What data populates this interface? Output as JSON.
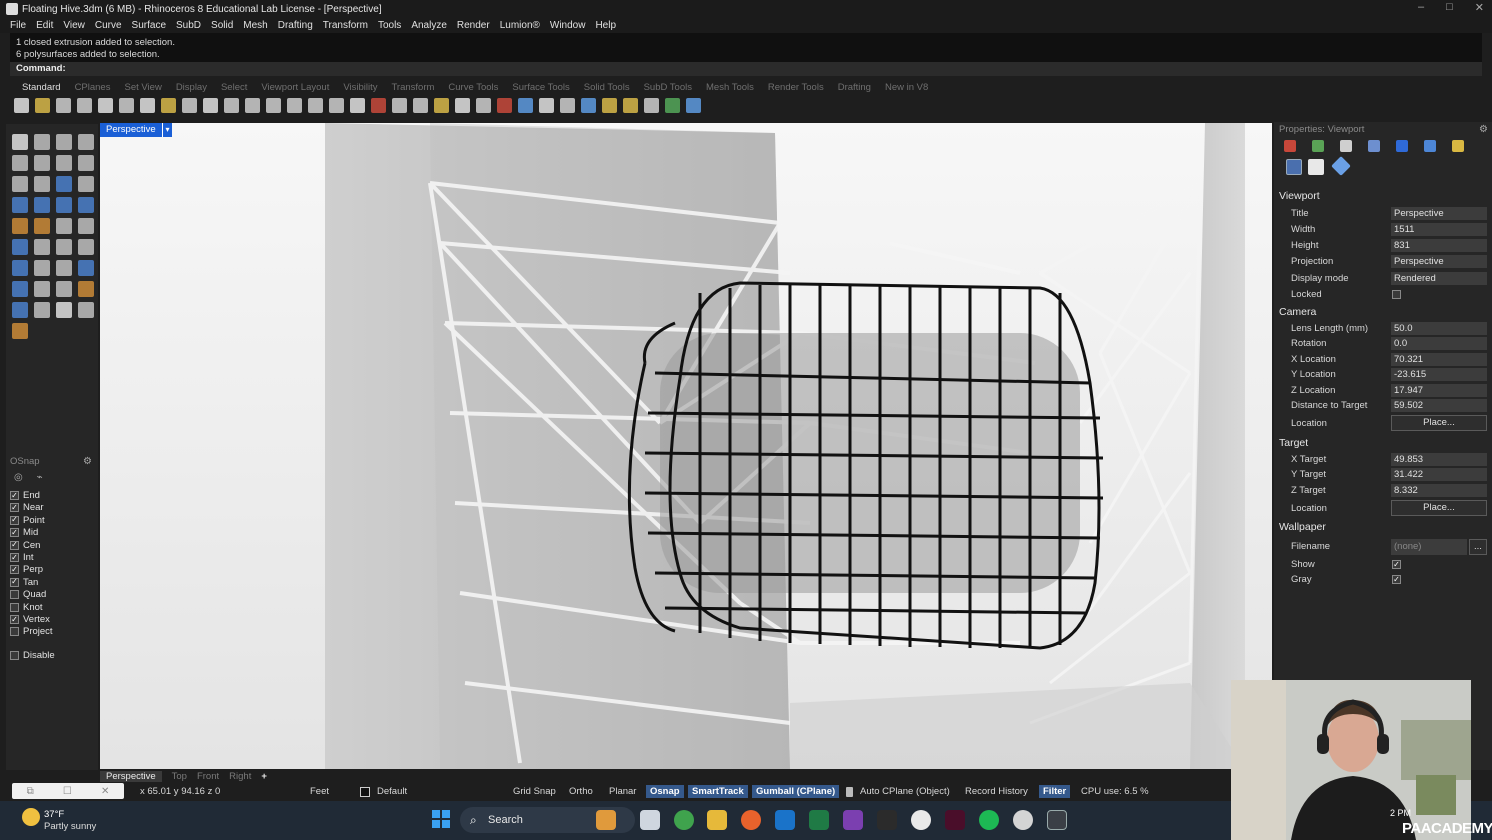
{
  "window": {
    "title": "Floating Hive.3dm (6 MB) - Rhinoceros 8 Educational Lab License - [Perspective]",
    "controls": [
      "–",
      "□",
      "✕"
    ]
  },
  "menu": [
    "File",
    "Edit",
    "View",
    "Curve",
    "Surface",
    "SubD",
    "Solid",
    "Mesh",
    "Drafting",
    "Transform",
    "Tools",
    "Analyze",
    "Render",
    "Lumion®",
    "Window",
    "Help"
  ],
  "command_history": [
    "1 closed extrusion added to selection.",
    "6 polysurfaces added to selection."
  ],
  "command_prompt": "Command:",
  "toolbar_tabs": [
    "Standard",
    "CPlanes",
    "Set View",
    "Display",
    "Select",
    "Viewport Layout",
    "Visibility",
    "Transform",
    "Curve Tools",
    "Surface Tools",
    "Solid Tools",
    "SubD Tools",
    "Mesh Tools",
    "Render Tools",
    "Drafting",
    "New in V8"
  ],
  "viewport": {
    "label": "Perspective",
    "tabs": [
      "Perspective",
      "Top",
      "Front",
      "Right"
    ],
    "add_tab": "+"
  },
  "osnap": {
    "title": "OSnap",
    "items": [
      {
        "label": "End",
        "checked": true
      },
      {
        "label": "Near",
        "checked": true
      },
      {
        "label": "Point",
        "checked": true
      },
      {
        "label": "Mid",
        "checked": true
      },
      {
        "label": "Cen",
        "checked": true
      },
      {
        "label": "Int",
        "checked": true
      },
      {
        "label": "Perp",
        "checked": true
      },
      {
        "label": "Tan",
        "checked": true
      },
      {
        "label": "Quad",
        "checked": false
      },
      {
        "label": "Knot",
        "checked": false
      },
      {
        "label": "Vertex",
        "checked": true
      },
      {
        "label": "Project",
        "checked": false
      }
    ],
    "disable": {
      "label": "Disable",
      "checked": false
    }
  },
  "properties": {
    "title": "Properties: Viewport",
    "viewport_section": "Viewport",
    "title_label": "Title",
    "title_value": "Perspective",
    "width_label": "Width",
    "width_value": "1511",
    "height_label": "Height",
    "height_value": "831",
    "projection_label": "Projection",
    "projection_value": "Perspective",
    "display_label": "Display mode",
    "display_value": "Rendered",
    "locked_label": "Locked",
    "camera_section": "Camera",
    "lens_label": "Lens Length (mm)",
    "lens_value": "50.0",
    "rotation_label": "Rotation",
    "rotation_value": "0.0",
    "xloc_label": "X Location",
    "xloc_value": "70.321",
    "yloc_label": "Y Location",
    "yloc_value": "-23.615",
    "zloc_label": "Z Location",
    "zloc_value": "17.947",
    "dist_label": "Distance to Target",
    "dist_value": "59.502",
    "cam_location_label": "Location",
    "place_label": "Place...",
    "target_section": "Target",
    "xt_label": "X Target",
    "xt_value": "49.853",
    "yt_label": "Y Target",
    "yt_value": "31.422",
    "zt_label": "Z Target",
    "zt_value": "8.332",
    "tgt_location_label": "Location",
    "wallpaper_section": "Wallpaper",
    "filename_label": "Filename",
    "filename_value": "(none)",
    "filename_browse": "...",
    "show_label": "Show",
    "gray_label": "Gray"
  },
  "status": {
    "coords": "x 65.01  y 94.16  z 0",
    "units": "Feet",
    "layer": "Default",
    "grid_snap": "Grid Snap",
    "ortho": "Ortho",
    "planar": "Planar",
    "osnap": "Osnap",
    "smarttrack": "SmartTrack",
    "gumball": "Gumball (CPlane)",
    "auto_cplane": "Auto CPlane (Object)",
    "record_history": "Record History",
    "filter": "Filter",
    "cpu": "CPU use: 6.5 %"
  },
  "taskbar": {
    "weather_temp": "37°F",
    "weather_desc": "Partly sunny",
    "search": "Search",
    "time": "2 PM",
    "brand": "PAACADEMY"
  },
  "colors": {
    "accent": "#1a5fd6",
    "status_highlight": "#35598c",
    "panel_bg": "#262626"
  }
}
